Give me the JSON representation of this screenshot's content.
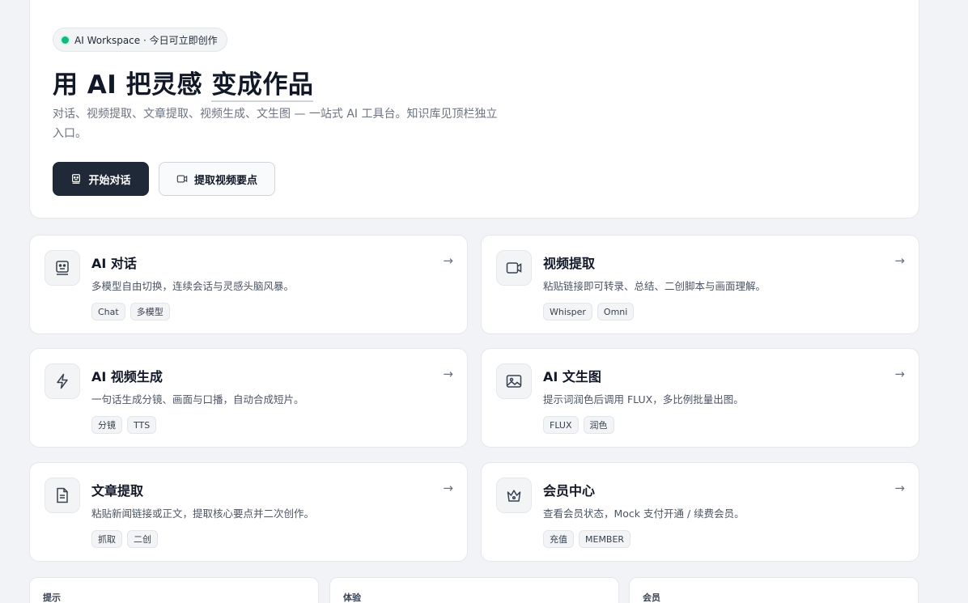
{
  "hero": {
    "badge": "AI Workspace · 今日可立即创作",
    "title_part1": "用 AI 把灵感 ",
    "title_highlight": "变成作品",
    "description": "对话、视频提取、文章提取、视频生成、文生图 — 一站式 AI 工具台。知识库见顶栏独立入口。",
    "primary_button": "开始对话",
    "secondary_button": "提取视频要点"
  },
  "cards": [
    {
      "icon": "chat-bot-icon",
      "title": "AI 对话",
      "desc": "多模型自由切换，连续会话与灵感头脑风暴。",
      "tags": [
        "Chat",
        "多模型"
      ]
    },
    {
      "icon": "video-camera-icon",
      "title": "视频提取",
      "desc": "粘贴链接即可转录、总结、二创脚本与画面理解。",
      "tags": [
        "Whisper",
        "Omni"
      ]
    },
    {
      "icon": "lightning-icon",
      "title": "AI 视频生成",
      "desc": "一句话生成分镜、画面与口播，自动合成短片。",
      "tags": [
        "分镜",
        "TTS"
      ]
    },
    {
      "icon": "image-icon",
      "title": "AI 文生图",
      "desc": "提示词润色后调用 FLUX，多比例批量出图。",
      "tags": [
        "FLUX",
        "润色"
      ]
    },
    {
      "icon": "document-icon",
      "title": "文章提取",
      "desc": "粘贴新闻链接或正文，提取核心要点并二次创作。",
      "tags": [
        "抓取",
        "二创"
      ]
    },
    {
      "icon": "crown-icon",
      "title": "会员中心",
      "desc": "查看会员状态，Mock 支付开通 / 续费会员。",
      "tags": [
        "充值",
        "MEMBER"
      ]
    }
  ],
  "arrow": "→",
  "bottom_cards": [
    "提示",
    "体验",
    "会员"
  ],
  "colors": {
    "accent_dark": "#1f2937",
    "status_green": "#10b981",
    "background": "#f1f3f6"
  }
}
